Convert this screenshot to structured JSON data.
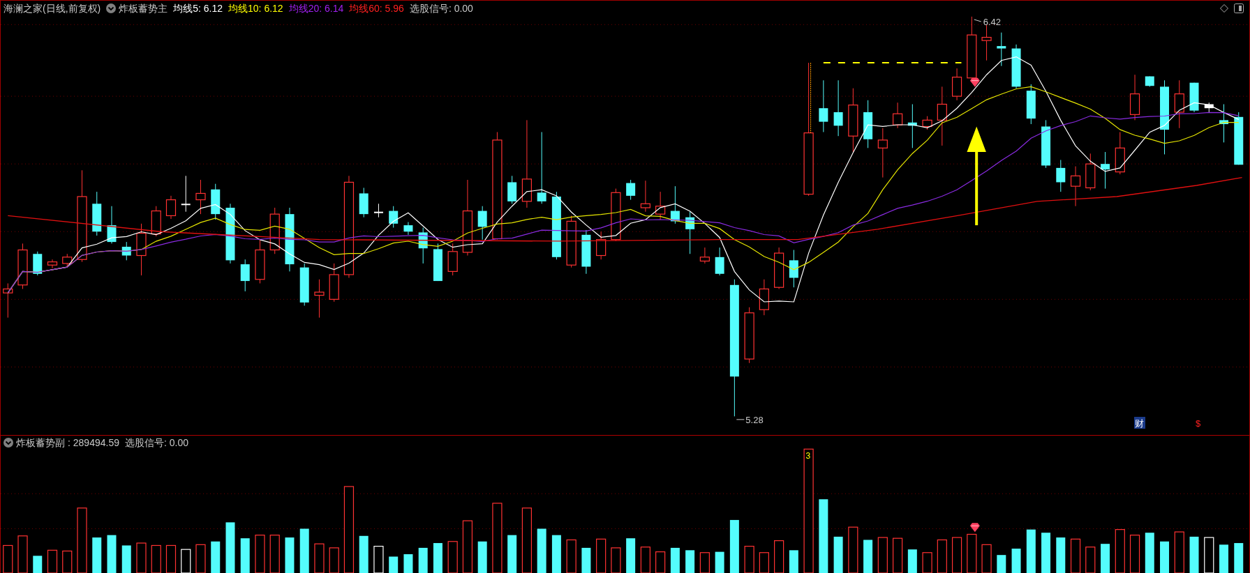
{
  "main_panel": {
    "title": "海澜之家(日线,前复权)",
    "indicator": "炸板蓄势主",
    "values": [
      {
        "label": "均线5: 6.12",
        "color": "#ffffff"
      },
      {
        "label": "均线10: 6.12",
        "color": "#ffff00"
      },
      {
        "label": "均线20: 6.14",
        "color": "#a020f0"
      },
      {
        "label": "均线60: 5.96",
        "color": "#ff2020"
      },
      {
        "label": "选股信号: 0.00",
        "color": "#c8c8c8"
      }
    ],
    "high_label": "6.42",
    "low_label": "5.28",
    "markers": [
      {
        "text": "财",
        "kind": "badge"
      },
      {
        "text": "$",
        "kind": "plain"
      }
    ]
  },
  "sub_panel": {
    "indicator": "炸板蓄势副",
    "reading": ": 289494.59",
    "signal": "选股信号: 0.00",
    "bar_label": "3"
  }
}
